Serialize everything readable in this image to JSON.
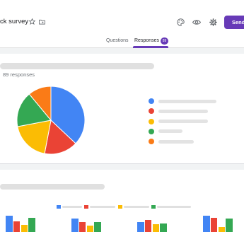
{
  "header": {
    "title": "ck survey",
    "send_label": "Send"
  },
  "tabs": {
    "questions": "Questions",
    "responses": "Responses",
    "response_badge": "89"
  },
  "summary": {
    "response_count_text": "89 responses"
  },
  "colors": {
    "accent": "#673ab7",
    "blue": "#4285f4",
    "red": "#ea4335",
    "yellow": "#fbbc04",
    "green": "#34a853",
    "orange": "#fa7b17"
  },
  "pie": {
    "slices": [
      {
        "color": "blue",
        "share": 0.37
      },
      {
        "color": "red",
        "share": 0.16
      },
      {
        "color": "yellow",
        "share": 0.19
      },
      {
        "color": "green",
        "share": 0.17
      },
      {
        "color": "orange",
        "share": 0.11
      }
    ]
  },
  "bar_groups": [
    {
      "values": [
        3.1,
        2.1,
        1.4,
        2.8
      ]
    },
    {
      "values": [
        2.6,
        1.9,
        1.3,
        1.9
      ]
    },
    {
      "values": [
        1.9,
        2.3,
        1.5,
        1.7
      ]
    },
    {
      "values": [
        3.1,
        2.8,
        1.0,
        2.6
      ]
    }
  ],
  "icons": [
    "star-icon",
    "folder-icon",
    "palette-icon",
    "eye-icon",
    "gear-icon"
  ]
}
